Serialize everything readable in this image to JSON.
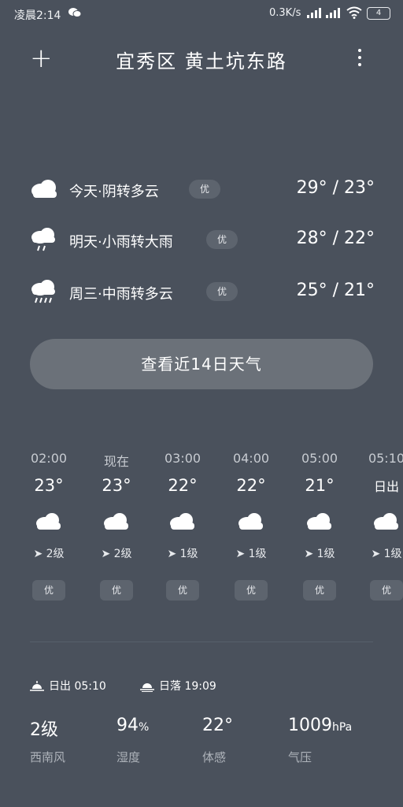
{
  "status_bar": {
    "time": "凌晨2:14",
    "speed": "0.3K/s",
    "battery": "4"
  },
  "header": {
    "title": "宜秀区 黄土坑东路"
  },
  "forecast": [
    {
      "day": "今天·阴转多云",
      "aqi": "优",
      "temp": "29° / 23°",
      "icon": "cloud-icon"
    },
    {
      "day": "明天·小雨转大雨",
      "aqi": "优",
      "temp": "28° / 22°",
      "icon": "light-rain-icon"
    },
    {
      "day": "周三·中雨转多云",
      "aqi": "优",
      "temp": "25° / 21°",
      "icon": "rain-icon"
    }
  ],
  "button_14day": "查看近14日天气",
  "hourly": [
    {
      "time": "02:00",
      "temp": "23°",
      "wind": "2级",
      "aqi": "优"
    },
    {
      "time": "现在",
      "temp": "23°",
      "wind": "2级",
      "aqi": "优"
    },
    {
      "time": "03:00",
      "temp": "22°",
      "wind": "1级",
      "aqi": "优"
    },
    {
      "time": "04:00",
      "temp": "22°",
      "wind": "1级",
      "aqi": "优"
    },
    {
      "time": "05:00",
      "temp": "21°",
      "wind": "1级",
      "aqi": "优"
    },
    {
      "time": "05:10",
      "temp": "日出",
      "wind": "1级",
      "aqi": "优"
    }
  ],
  "sun": {
    "sunrise": "日出 05:10",
    "sunset": "日落 19:09"
  },
  "details": [
    {
      "value": "2级",
      "unit": "",
      "label": "西南风"
    },
    {
      "value": "94",
      "unit": "%",
      "label": "湿度"
    },
    {
      "value": "22°",
      "unit": "",
      "label": "体感"
    },
    {
      "value": "1009",
      "unit": "hPa",
      "label": "气压"
    }
  ],
  "colors": {
    "background": "#4a515c",
    "badge": "#5d646e",
    "button": "#6b7179"
  }
}
